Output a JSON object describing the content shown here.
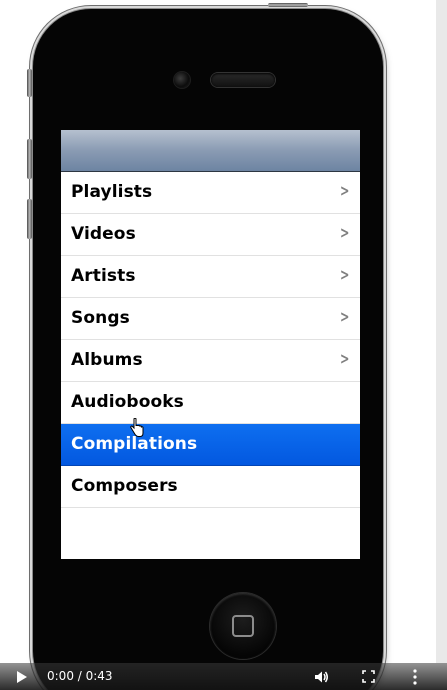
{
  "menu": {
    "items": [
      {
        "label": "Playlists",
        "chevron": true,
        "selected": false
      },
      {
        "label": "Videos",
        "chevron": true,
        "selected": false
      },
      {
        "label": "Artists",
        "chevron": true,
        "selected": false
      },
      {
        "label": "Songs",
        "chevron": true,
        "selected": false
      },
      {
        "label": "Albums",
        "chevron": true,
        "selected": false
      },
      {
        "label": "Audiobooks",
        "chevron": false,
        "selected": false
      },
      {
        "label": "Compilations",
        "chevron": false,
        "selected": true
      },
      {
        "label": "Composers",
        "chevron": false,
        "selected": false
      }
    ],
    "chevron_glyph": ">"
  },
  "player": {
    "time": "0:00 / 0:43",
    "icons": [
      "play-icon",
      "volume-icon",
      "fullscreen-icon",
      "more-options-icon"
    ]
  },
  "colors": {
    "selected_row": "#0358e0",
    "navbar": "#8a9bb3"
  }
}
